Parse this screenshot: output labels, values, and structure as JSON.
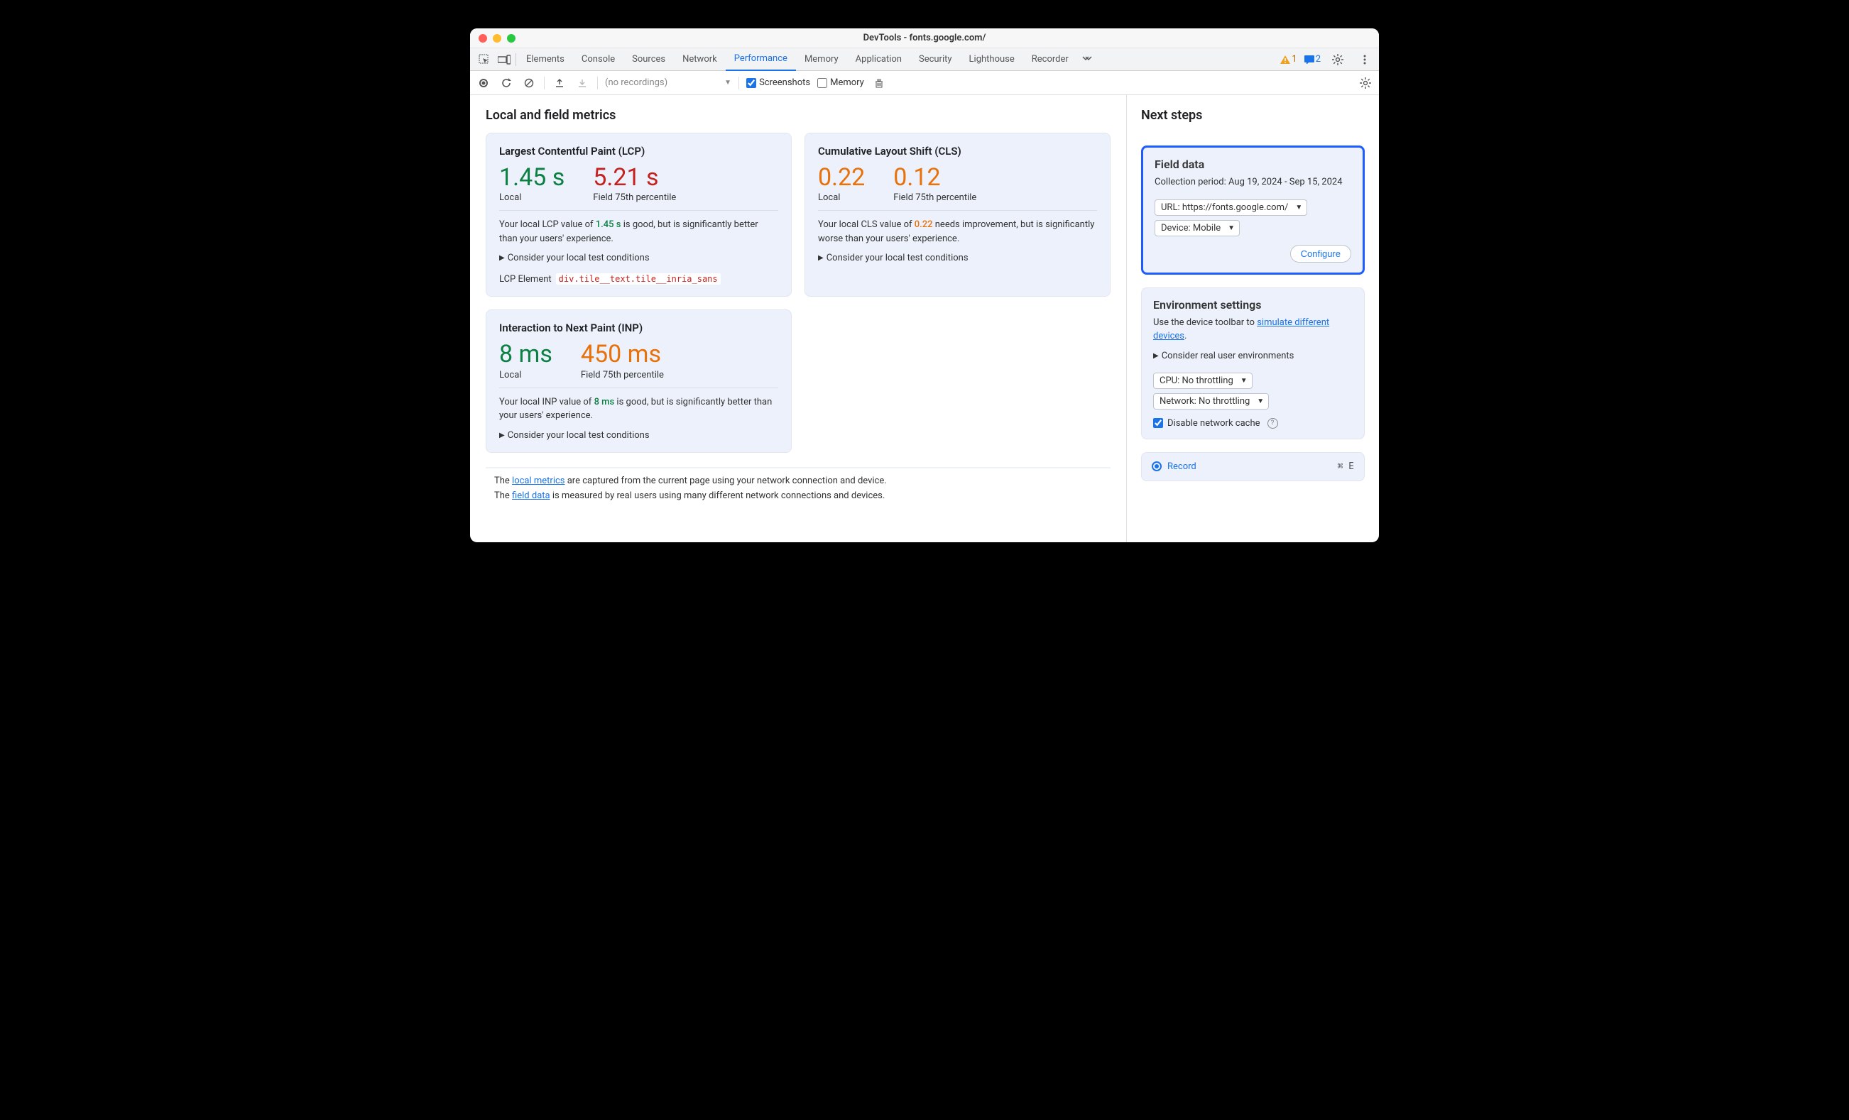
{
  "title": "DevTools - fonts.google.com/",
  "tabs": [
    "Elements",
    "Console",
    "Sources",
    "Network",
    "Performance",
    "Memory",
    "Application",
    "Security",
    "Lighthouse",
    "Recorder"
  ],
  "activeTab": "Performance",
  "warnings": "1",
  "messages": "2",
  "toolbar": {
    "recordings": "(no recordings)",
    "screenshots": "Screenshots",
    "memory": "Memory"
  },
  "main": {
    "heading": "Local and field metrics",
    "lcp": {
      "title": "Largest Contentful Paint (LCP)",
      "localVal": "1.45 s",
      "localLbl": "Local",
      "fieldVal": "5.21 s",
      "fieldLbl": "Field 75th percentile",
      "desc_pre": "Your local LCP value of ",
      "desc_val": "1.45 s",
      "desc_post": " is good, but is significantly better than your users' experience.",
      "expand": "Consider your local test conditions",
      "elemLbl": "LCP Element",
      "elemCode": "div.tile__text.tile__inria_sans"
    },
    "cls": {
      "title": "Cumulative Layout Shift (CLS)",
      "localVal": "0.22",
      "localLbl": "Local",
      "fieldVal": "0.12",
      "fieldLbl": "Field 75th percentile",
      "desc_pre": "Your local CLS value of ",
      "desc_val": "0.22",
      "desc_post": " needs improvement, but is significantly worse than your users' experience.",
      "expand": "Consider your local test conditions"
    },
    "inp": {
      "title": "Interaction to Next Paint (INP)",
      "localVal": "8 ms",
      "localLbl": "Local",
      "fieldVal": "450 ms",
      "fieldLbl": "Field 75th percentile",
      "desc_pre": "Your local INP value of ",
      "desc_val": "8 ms",
      "desc_post": " is good, but is significantly better than your users' experience.",
      "expand": "Consider your local test conditions"
    },
    "footnote": {
      "l1a": "The ",
      "l1link": "local metrics",
      "l1b": " are captured from the current page using your network connection and device.",
      "l2a": "The ",
      "l2link": "field data",
      "l2b": " is measured by real users using many different network connections and devices."
    }
  },
  "side": {
    "heading": "Next steps",
    "field": {
      "title": "Field data",
      "period": "Collection period: Aug 19, 2024 - Sep 15, 2024",
      "url": "URL: https://fonts.google.com/",
      "device": "Device: Mobile",
      "configure": "Configure"
    },
    "env": {
      "title": "Environment settings",
      "desc_pre": "Use the device toolbar to ",
      "desc_link": "simulate different devices",
      "expand": "Consider real user environments",
      "cpu": "CPU: No throttling",
      "net": "Network: No throttling",
      "cache": "Disable network cache"
    },
    "record": {
      "label": "Record",
      "shortcut": "⌘ E"
    }
  }
}
